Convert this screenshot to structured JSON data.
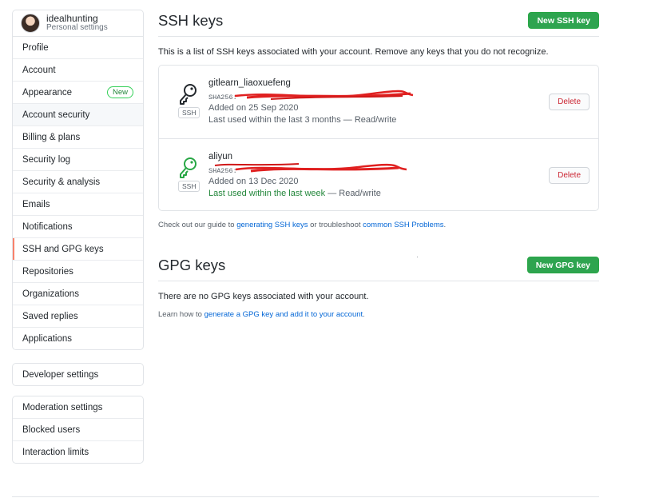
{
  "sidebar": {
    "user": {
      "name": "idealhunting",
      "subtitle": "Personal settings"
    },
    "items": [
      {
        "label": "Profile"
      },
      {
        "label": "Account"
      },
      {
        "label": "Appearance",
        "badge": "New"
      },
      {
        "label": "Account security"
      },
      {
        "label": "Billing & plans"
      },
      {
        "label": "Security log"
      },
      {
        "label": "Security & analysis"
      },
      {
        "label": "Emails"
      },
      {
        "label": "Notifications"
      },
      {
        "label": "SSH and GPG keys"
      },
      {
        "label": "Repositories"
      },
      {
        "label": "Organizations"
      },
      {
        "label": "Saved replies"
      },
      {
        "label": "Applications"
      }
    ],
    "developer": {
      "label": "Developer settings"
    },
    "moderation": {
      "heading": "Moderation settings",
      "items": [
        {
          "label": "Blocked users"
        },
        {
          "label": "Interaction limits"
        }
      ]
    }
  },
  "ssh": {
    "title": "SSH keys",
    "new_button": "New SSH key",
    "intro": "This is a list of SSH keys associated with your account. Remove any keys that you do not recognize.",
    "keys": [
      {
        "title": "gitlearn_liaoxuefeng",
        "fingerprint": "SHA256:",
        "type_label": "SSH",
        "added": "Added on 25 Sep 2020",
        "last_used": "Last used within the last 3 months",
        "access": " — Read/write",
        "delete": "Delete",
        "icon_color": "#24292e"
      },
      {
        "title": "aliyun",
        "fingerprint": "SHA256:",
        "type_label": "SSH",
        "added": "Added on 13 Dec 2020",
        "last_used": "Last used within the last week",
        "access": " — Read/write",
        "delete": "Delete",
        "icon_color": "#28a745"
      }
    ],
    "guide": {
      "prefix": "Check out our guide to ",
      "link1": "generating SSH keys",
      "middle": " or troubleshoot ",
      "link2": "common SSH Problems",
      "suffix": "."
    }
  },
  "gpg": {
    "title": "GPG keys",
    "new_button": "New GPG key",
    "empty": "There are no GPG keys associated with your account.",
    "learn_prefix": "Learn how to ",
    "learn_link": "generate a GPG key and add it to your account",
    "learn_suffix": "."
  },
  "colors": {
    "accent_green": "#2ea44f",
    "selected_marker": "#f9826c",
    "danger": "#cb2431",
    "link": "#0366d6",
    "redaction": "#e02020"
  }
}
